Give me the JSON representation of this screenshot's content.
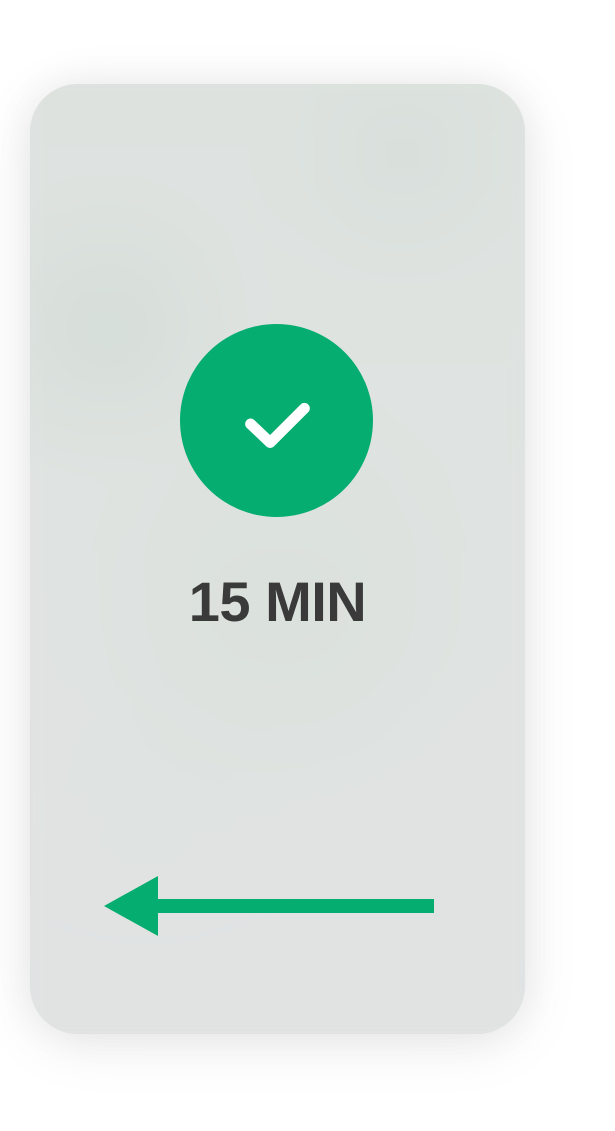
{
  "screen": {
    "duration_text": "15 MIN"
  },
  "colors": {
    "accent": "#06ad70",
    "text": "#3a3a3a",
    "card_background": "#dfe2e1"
  },
  "icons": {
    "status_icon": "check-icon",
    "navigation_icon": "arrow-left-icon"
  }
}
